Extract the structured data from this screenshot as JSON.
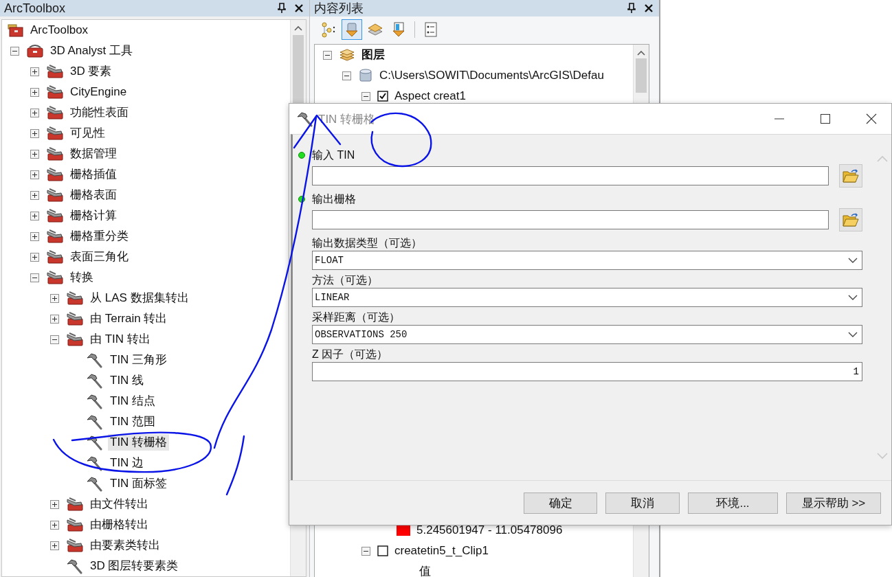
{
  "toolbox_panel": {
    "title": "ArcToolbox",
    "tree": [
      {
        "label": "ArcToolbox",
        "kind": "root",
        "selected": false,
        "children": [
          {
            "label": "3D Analyst 工具",
            "kind": "toolbox",
            "expanded": true,
            "selected": false,
            "children": [
              {
                "label": "3D 要素",
                "kind": "toolset",
                "expanded": false,
                "selected": false
              },
              {
                "label": "CityEngine",
                "kind": "toolset",
                "expanded": false,
                "selected": false
              },
              {
                "label": "功能性表面",
                "kind": "toolset",
                "expanded": false,
                "selected": false
              },
              {
                "label": "可见性",
                "kind": "toolset",
                "expanded": false,
                "selected": false
              },
              {
                "label": "数据管理",
                "kind": "toolset",
                "expanded": false,
                "selected": false
              },
              {
                "label": "栅格插值",
                "kind": "toolset",
                "expanded": false,
                "selected": false
              },
              {
                "label": "栅格表面",
                "kind": "toolset",
                "expanded": false,
                "selected": false
              },
              {
                "label": "栅格计算",
                "kind": "toolset",
                "expanded": false,
                "selected": false
              },
              {
                "label": "栅格重分类",
                "kind": "toolset",
                "expanded": false,
                "selected": false
              },
              {
                "label": "表面三角化",
                "kind": "toolset",
                "expanded": false,
                "selected": false
              },
              {
                "label": "转换",
                "kind": "toolset",
                "expanded": true,
                "selected": false,
                "children": [
                  {
                    "label": "从 LAS 数据集转出",
                    "kind": "toolset",
                    "expanded": false,
                    "selected": false
                  },
                  {
                    "label": "由 Terrain 转出",
                    "kind": "toolset",
                    "expanded": false,
                    "selected": false
                  },
                  {
                    "label": "由 TIN 转出",
                    "kind": "toolset",
                    "expanded": true,
                    "selected": false,
                    "children": [
                      {
                        "label": "TIN 三角形",
                        "kind": "tool",
                        "selected": false
                      },
                      {
                        "label": "TIN 线",
                        "kind": "tool",
                        "selected": false
                      },
                      {
                        "label": "TIN 结点",
                        "kind": "tool",
                        "selected": false
                      },
                      {
                        "label": "TIN 范围",
                        "kind": "tool",
                        "selected": false
                      },
                      {
                        "label": "TIN 转栅格",
                        "kind": "tool",
                        "selected": true
                      },
                      {
                        "label": "TIN 边",
                        "kind": "tool",
                        "selected": false
                      },
                      {
                        "label": "TIN 面标签",
                        "kind": "tool",
                        "selected": false
                      }
                    ]
                  },
                  {
                    "label": "由文件转出",
                    "kind": "toolset",
                    "expanded": false,
                    "selected": false
                  },
                  {
                    "label": "由栅格转出",
                    "kind": "toolset",
                    "expanded": false,
                    "selected": false
                  },
                  {
                    "label": "由要素类转出",
                    "kind": "toolset",
                    "expanded": false,
                    "selected": false
                  },
                  {
                    "label": "3D 图层转要素类",
                    "kind": "tool",
                    "selected": false
                  }
                ]
              }
            ]
          }
        ]
      }
    ]
  },
  "contents_panel": {
    "title": "内容列表",
    "toolbar": [
      {
        "kind": "drawing-order",
        "selected": false
      },
      {
        "kind": "source",
        "selected": true
      },
      {
        "kind": "visibility",
        "selected": false
      },
      {
        "kind": "selection",
        "selected": false
      },
      {
        "kind": "options",
        "selected": false
      }
    ],
    "top_rows": [
      {
        "label": "图层",
        "kind": "frame",
        "expanded": true,
        "children": [
          {
            "label": "C:\\Users\\SOWIT\\Documents\\ArcGIS\\Defau",
            "kind": "workspace",
            "expanded": true,
            "children": [
              {
                "label": "Aspect creat1",
                "kind": "layer",
                "expanded": true,
                "checked": true
              }
            ]
          }
        ]
      }
    ],
    "bottom_rows": [
      {
        "label": "5.245601947 - 11.05478096",
        "kind": "legend",
        "color": "#ff0000"
      },
      {
        "label": "createtin5_t_Clip1",
        "kind": "layer",
        "expanded": true,
        "checked": false,
        "children": [
          {
            "label": "值",
            "kind": "field"
          }
        ]
      }
    ]
  },
  "dialog": {
    "title": "TIN 转栅格",
    "fields": [
      {
        "label": "输入 TIN",
        "kind": "path",
        "required": true
      },
      {
        "label": "输出栅格",
        "kind": "path",
        "required": true
      },
      {
        "label": "输出数据类型（可选）",
        "kind": "dropdown",
        "required": false,
        "value": "FLOAT"
      },
      {
        "label": "方法（可选）",
        "kind": "dropdown",
        "required": false,
        "value": "LINEAR"
      },
      {
        "label": "采样距离（可选）",
        "kind": "dropdown",
        "required": false,
        "value": "OBSERVATIONS 250"
      },
      {
        "label": "Z 因子（可选）",
        "kind": "number",
        "required": false,
        "value": "1"
      }
    ],
    "buttons": [
      "确定",
      "取消",
      "环境...",
      "显示帮助 >>"
    ]
  }
}
